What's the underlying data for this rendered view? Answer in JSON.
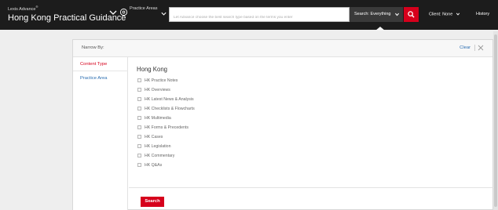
{
  "header": {
    "brand_small": "Lexis Advance",
    "brand_reg": "®",
    "brand_title": "Hong Kong Practical Guidance",
    "practice_areas_label": "Practice Areas",
    "search_placeholder": "Let Advance choose the best search type based on the terms you enter",
    "search_scope": "Search: Everything",
    "client_label": "Client: None",
    "history_label": "History"
  },
  "panel": {
    "narrow_by": "Narrow By:",
    "clear": "Clear",
    "sidebar": [
      {
        "label": "Content Type",
        "active": true
      },
      {
        "label": "Practice Area",
        "active": false
      }
    ],
    "region_title": "Hong Kong",
    "options": [
      {
        "label": "HK Practice Notes",
        "checked": false
      },
      {
        "label": "HK Overviews",
        "checked": false
      },
      {
        "label": "HK Latest News & Analysis",
        "checked": false
      },
      {
        "label": "HK Checklists & Flowcharts",
        "checked": false
      },
      {
        "label": "HK Multimedia",
        "checked": false
      },
      {
        "label": "HK Forms & Precedents",
        "checked": false
      },
      {
        "label": "HK Cases",
        "checked": false
      },
      {
        "label": "HK Legislation",
        "checked": false
      },
      {
        "label": "HK Commentary",
        "checked": false
      },
      {
        "label": "HK Q&As",
        "checked": false
      }
    ],
    "submit_label": "Search"
  },
  "colors": {
    "brand_red": "#d6001c",
    "topbar": "#1c1c1c",
    "link_blue": "#2a6db0"
  }
}
